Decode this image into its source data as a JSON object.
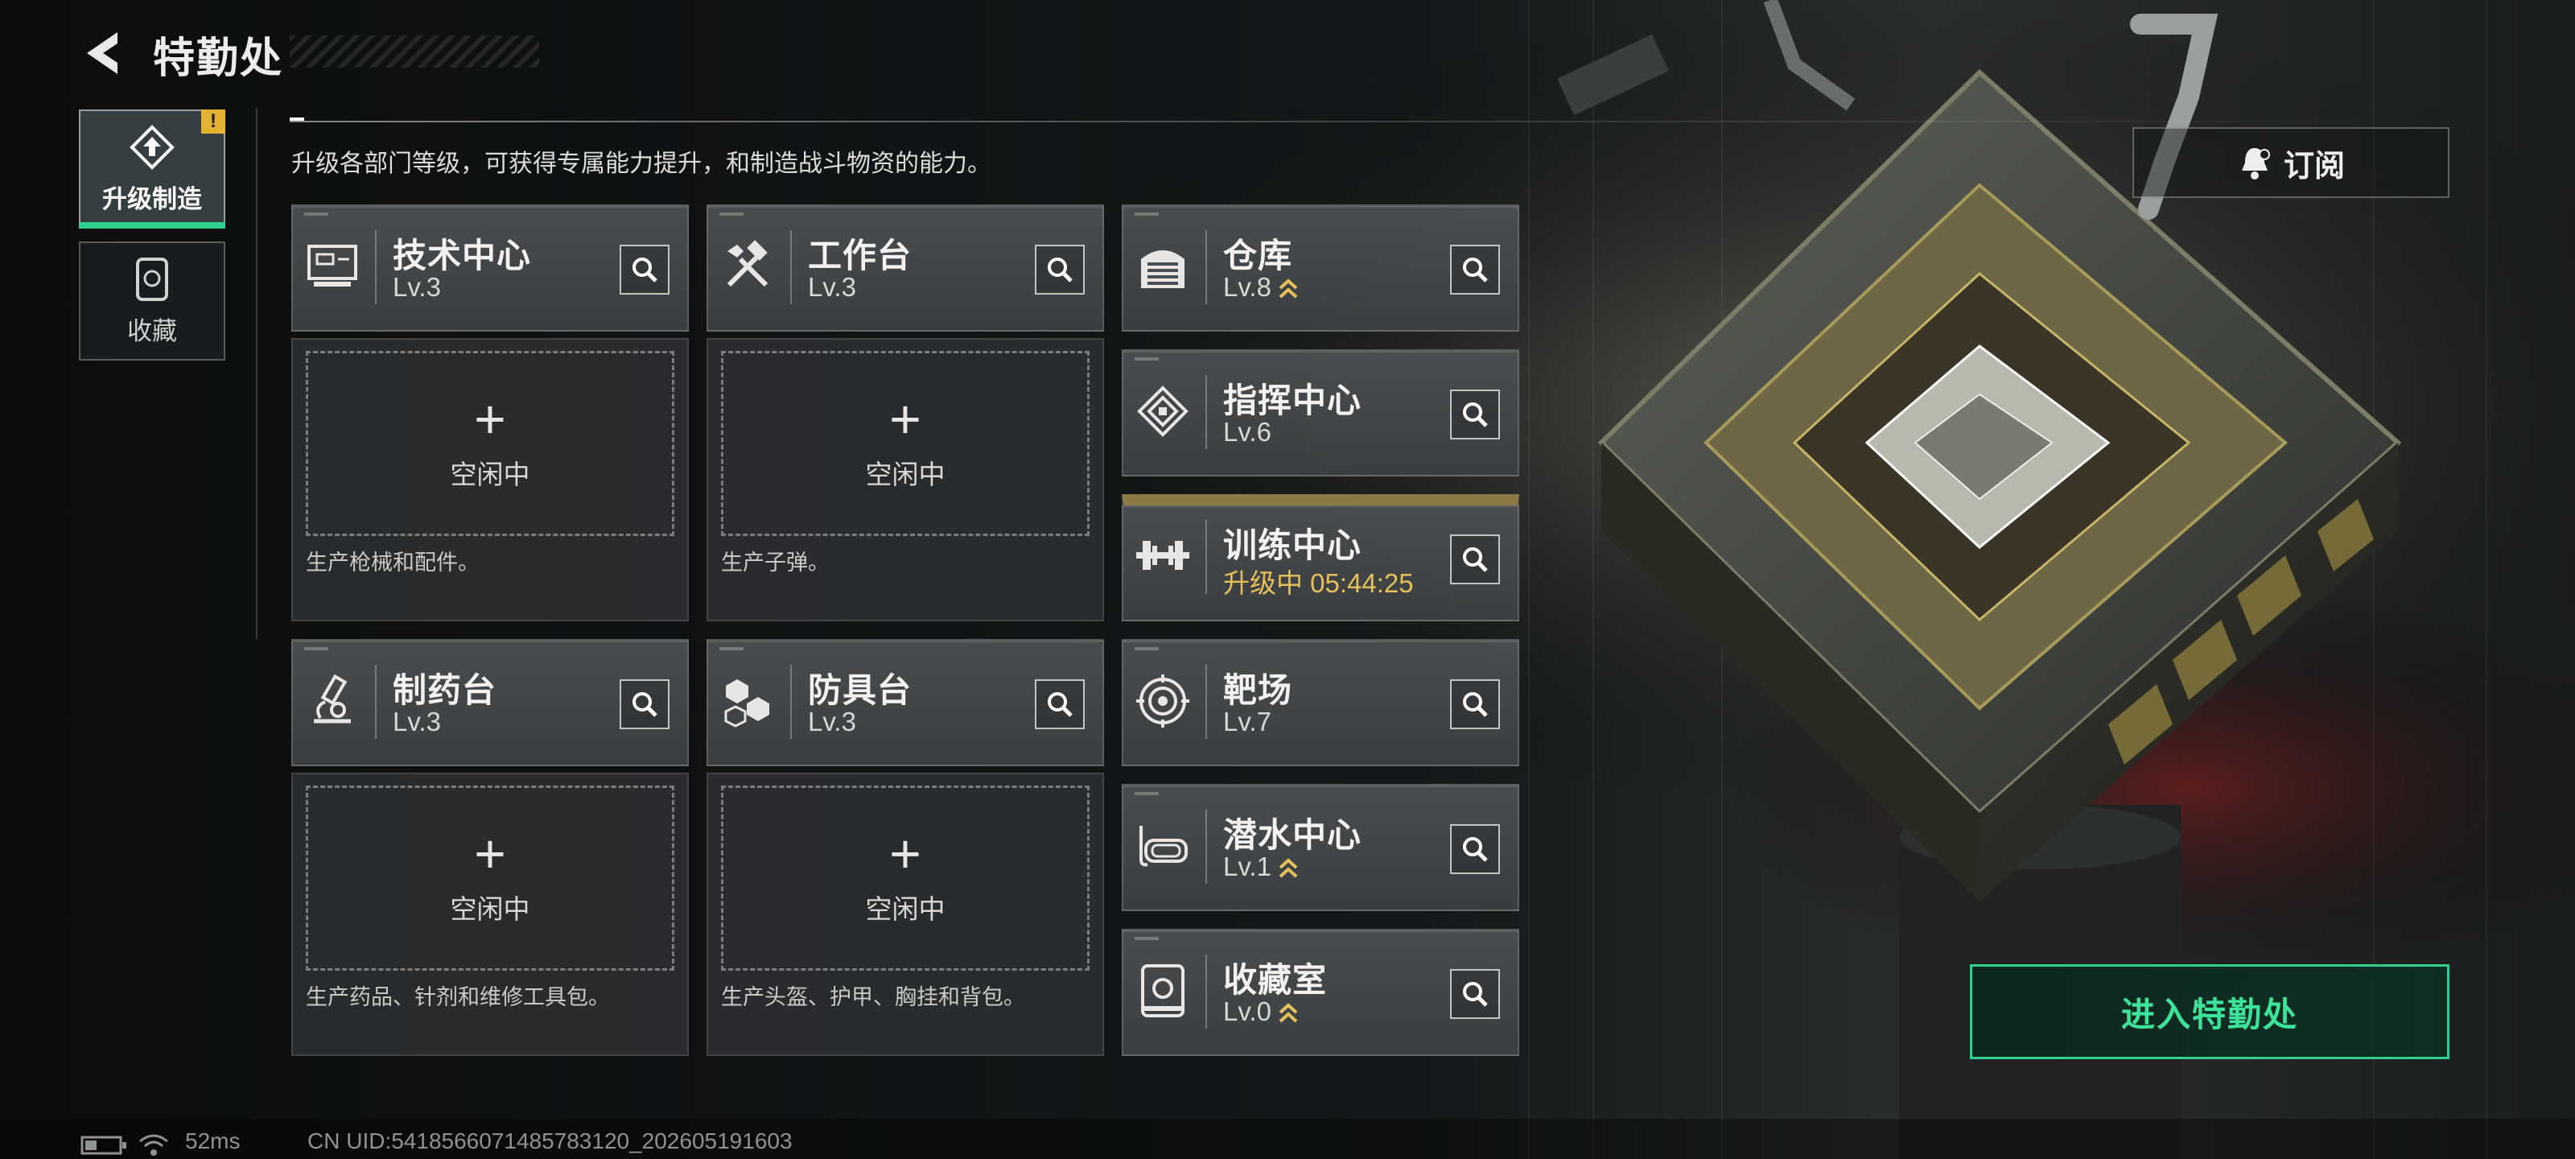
{
  "header": {
    "title": "特勤处"
  },
  "description": "升级各部门等级，可获得专属能力提升，和制造战斗物资的能力。",
  "sidebar": {
    "items": [
      {
        "label": "升级制造",
        "icon": "upgrade-icon",
        "active": true,
        "badge": "!"
      },
      {
        "label": "收藏",
        "icon": "collection-icon",
        "active": false
      }
    ]
  },
  "production": [
    {
      "name": "技术中心",
      "level": "Lv.3",
      "icon": "tech-center-icon",
      "slot_status": "空闲中",
      "slot_desc": "生产枪械和配件。"
    },
    {
      "name": "工作台",
      "level": "Lv.3",
      "icon": "workbench-icon",
      "slot_status": "空闲中",
      "slot_desc": "生产子弹。"
    },
    {
      "name": "制药台",
      "level": "Lv.3",
      "icon": "pharmacy-icon",
      "slot_status": "空闲中",
      "slot_desc": "生产药品、针剂和维修工具包。"
    },
    {
      "name": "防具台",
      "level": "Lv.3",
      "icon": "armor-bench-icon",
      "slot_status": "空闲中",
      "slot_desc": "生产头盔、护甲、胸挂和背包。"
    }
  ],
  "facilities": [
    {
      "name": "仓库",
      "level": "Lv.8",
      "icon": "warehouse-icon",
      "upgradable": true
    },
    {
      "name": "指挥中心",
      "level": "Lv.6",
      "icon": "command-center-icon",
      "upgradable": false
    },
    {
      "name": "训练中心",
      "level": "升级中 05:44:25",
      "icon": "training-center-icon",
      "upgrading": true
    },
    {
      "name": "靶场",
      "level": "Lv.7",
      "icon": "shooting-range-icon",
      "upgradable": false
    },
    {
      "name": "潜水中心",
      "level": "Lv.1",
      "icon": "diving-center-icon",
      "upgradable": true
    },
    {
      "name": "收藏室",
      "level": "Lv.0",
      "icon": "collection-room-icon",
      "upgradable": true
    }
  ],
  "actions": {
    "subscribe": "订阅",
    "enter": "进入特勤处"
  },
  "status_bar": {
    "ping": "52ms",
    "uid": "CN UID:5418566071485783120_202605191603"
  },
  "colors": {
    "accent_green": "#2fd08c",
    "gold": "#e5c05a",
    "panel": "#4c5052"
  }
}
